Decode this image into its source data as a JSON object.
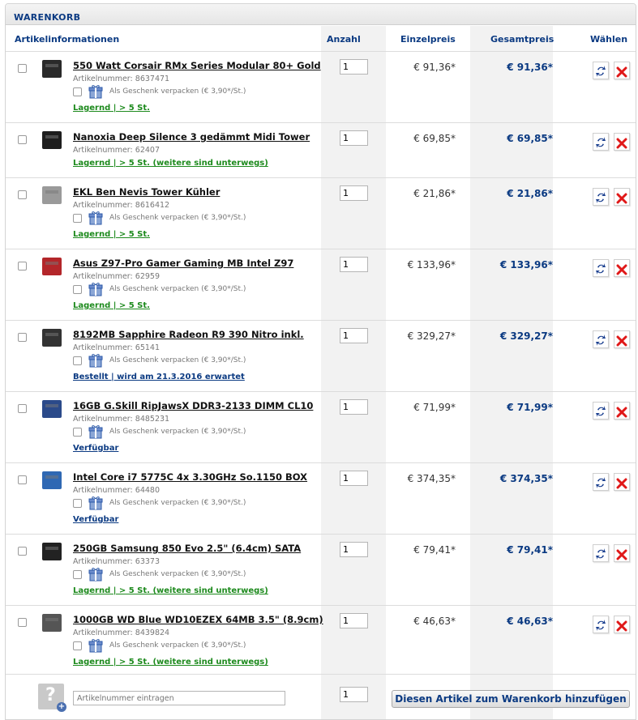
{
  "header": {
    "title": "WARENKORB"
  },
  "columns": {
    "article": "Artikelinformationen",
    "qty": "Anzahl",
    "unit": "Einzelpreis",
    "total": "Gesamtpreis",
    "choose": "Wählen"
  },
  "items": [
    {
      "name": "550 Watt Corsair RMx Series Modular 80+ Gold",
      "artnr": "Artikelnummer: 8637471",
      "gift": "Als Geschenk verpacken (€ 3,90*/St.)",
      "availability": "Lagernd | > 5 St.",
      "qty": "1",
      "unit_price": "€ 91,36*",
      "total_price": "€ 91,36*"
    },
    {
      "name": "Nanoxia Deep Silence 3 gedämmt Midi Tower",
      "artnr": "Artikelnummer: 62407",
      "availability": "Lagernd | > 5 St. (weitere sind unterwegs)",
      "qty": "1",
      "unit_price": "€ 69,85*",
      "total_price": "€ 69,85*"
    },
    {
      "name": "EKL Ben Nevis Tower Kühler",
      "artnr": "Artikelnummer: 8616412",
      "gift": "Als Geschenk verpacken (€ 3,90*/St.)",
      "availability": "Lagernd | > 5 St.",
      "qty": "1",
      "unit_price": "€ 21,86*",
      "total_price": "€ 21,86*"
    },
    {
      "name": "Asus Z97-Pro Gamer Gaming MB Intel Z97",
      "artnr": "Artikelnummer: 62959",
      "gift": "Als Geschenk verpacken (€ 3,90*/St.)",
      "availability": "Lagernd | > 5 St.",
      "qty": "1",
      "unit_price": "€ 133,96*",
      "total_price": "€ 133,96*"
    },
    {
      "name": "8192MB Sapphire Radeon R9 390 Nitro inkl.",
      "artnr": "Artikelnummer: 65141",
      "gift": "Als Geschenk verpacken (€ 3,90*/St.)",
      "availability": "Bestellt | wird am 21.3.2016 erwartet",
      "qty": "1",
      "unit_price": "€ 329,27*",
      "total_price": "€ 329,27*"
    },
    {
      "name": "16GB G.Skill RipJawsX DDR3-2133 DIMM CL10",
      "artnr": "Artikelnummer: 8485231",
      "gift": "Als Geschenk verpacken (€ 3,90*/St.)",
      "availability": "Verfügbar",
      "qty": "1",
      "unit_price": "€ 71,99*",
      "total_price": "€ 71,99*"
    },
    {
      "name": "Intel Core i7 5775C 4x 3.30GHz So.1150 BOX",
      "artnr": "Artikelnummer: 64480",
      "gift": "Als Geschenk verpacken (€ 3,90*/St.)",
      "availability": "Verfügbar",
      "qty": "1",
      "unit_price": "€ 374,35*",
      "total_price": "€ 374,35*"
    },
    {
      "name": "250GB Samsung 850 Evo 2.5\" (6.4cm) SATA",
      "artnr": "Artikelnummer: 63373",
      "gift": "Als Geschenk verpacken (€ 3,90*/St.)",
      "availability": "Lagernd | > 5 St. (weitere sind unterwegs)",
      "qty": "1",
      "unit_price": "€ 79,41*",
      "total_price": "€ 79,41*"
    },
    {
      "name": "1000GB WD Blue WD10EZEX 64MB 3.5\" (8.9cm)",
      "artnr": "Artikelnummer: 8439824",
      "gift": "Als Geschenk verpacken (€ 3,90*/St.)",
      "availability": "Lagernd | > 5 St. (weitere sind unterwegs)",
      "qty": "1",
      "unit_price": "€ 46,63*",
      "total_price": "€ 46,63*"
    }
  ],
  "add_row": {
    "placeholder": "Artikelnummer eintragen",
    "qty": "1",
    "button": "Diesen Artikel zum Warenkorb hinzufügen"
  },
  "colors": {
    "accent": "#0b3a82",
    "in_stock": "#1d8a1d",
    "delete": "#e01818"
  },
  "icons": {
    "update": "refresh-icon",
    "delete": "delete-icon",
    "gift": "gift-icon",
    "unknown_product": "question-icon"
  }
}
